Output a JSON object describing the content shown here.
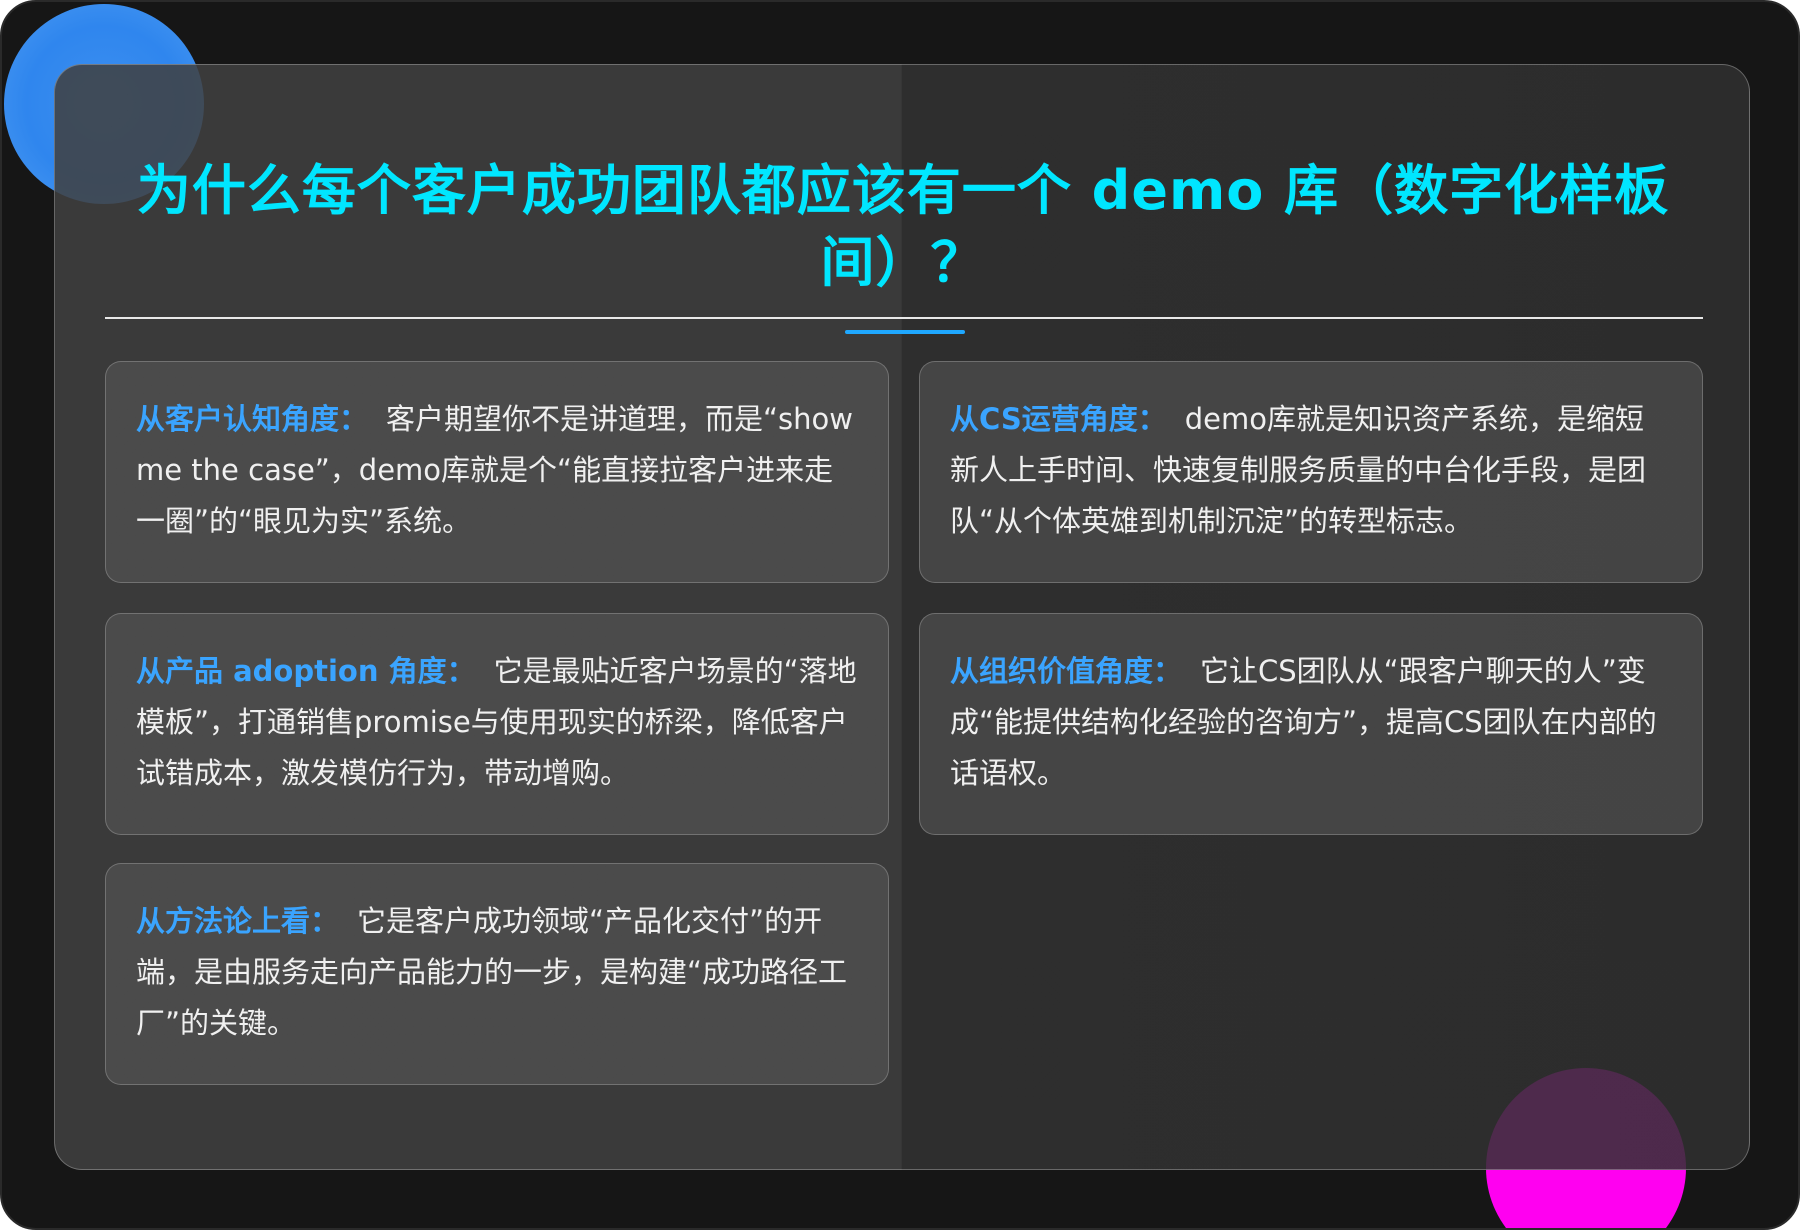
{
  "page": {
    "title": "为什么每个客户成功团队都应该有一个 demo 库（数字化样板间）？"
  },
  "colors": {
    "title": "#00e6ff",
    "lead": "#3aa4ff",
    "accent_line": "#1fa8ff",
    "blob_blue": "#2f86ee",
    "blob_pink": "#ff00f0"
  },
  "cards": [
    {
      "lead": "从客户认知角度：",
      "body": "客户期望你不是讲道理，而是“show me the case”，demo库就是个“能直接拉客户进来走一圈”的“眼见为实”系统。"
    },
    {
      "lead": "从CS运营角度：",
      "body": "demo库就是知识资产系统，是缩短新人上手时间、快速复制服务质量的中台化手段，是团队“从个体英雄到机制沉淀”的转型标志。"
    },
    {
      "lead": "从产品 adoption 角度：",
      "body": "它是最贴近客户场景的“落地模板”，打通销售promise与使用现实的桥梁，降低客户试错成本，激发模仿行为，带动增购。"
    },
    {
      "lead": "从组织价值角度：",
      "body": "它让CS团队从“跟客户聊天的人”变成“能提供结构化经验的咨询方”，提高CS团队在内部的话语权。"
    },
    {
      "lead": "从方法论上看：",
      "body": "它是客户成功领域“产品化交付”的开端，是由服务走向产品能力的一步，是构建“成功路径工厂”的关键。"
    }
  ]
}
